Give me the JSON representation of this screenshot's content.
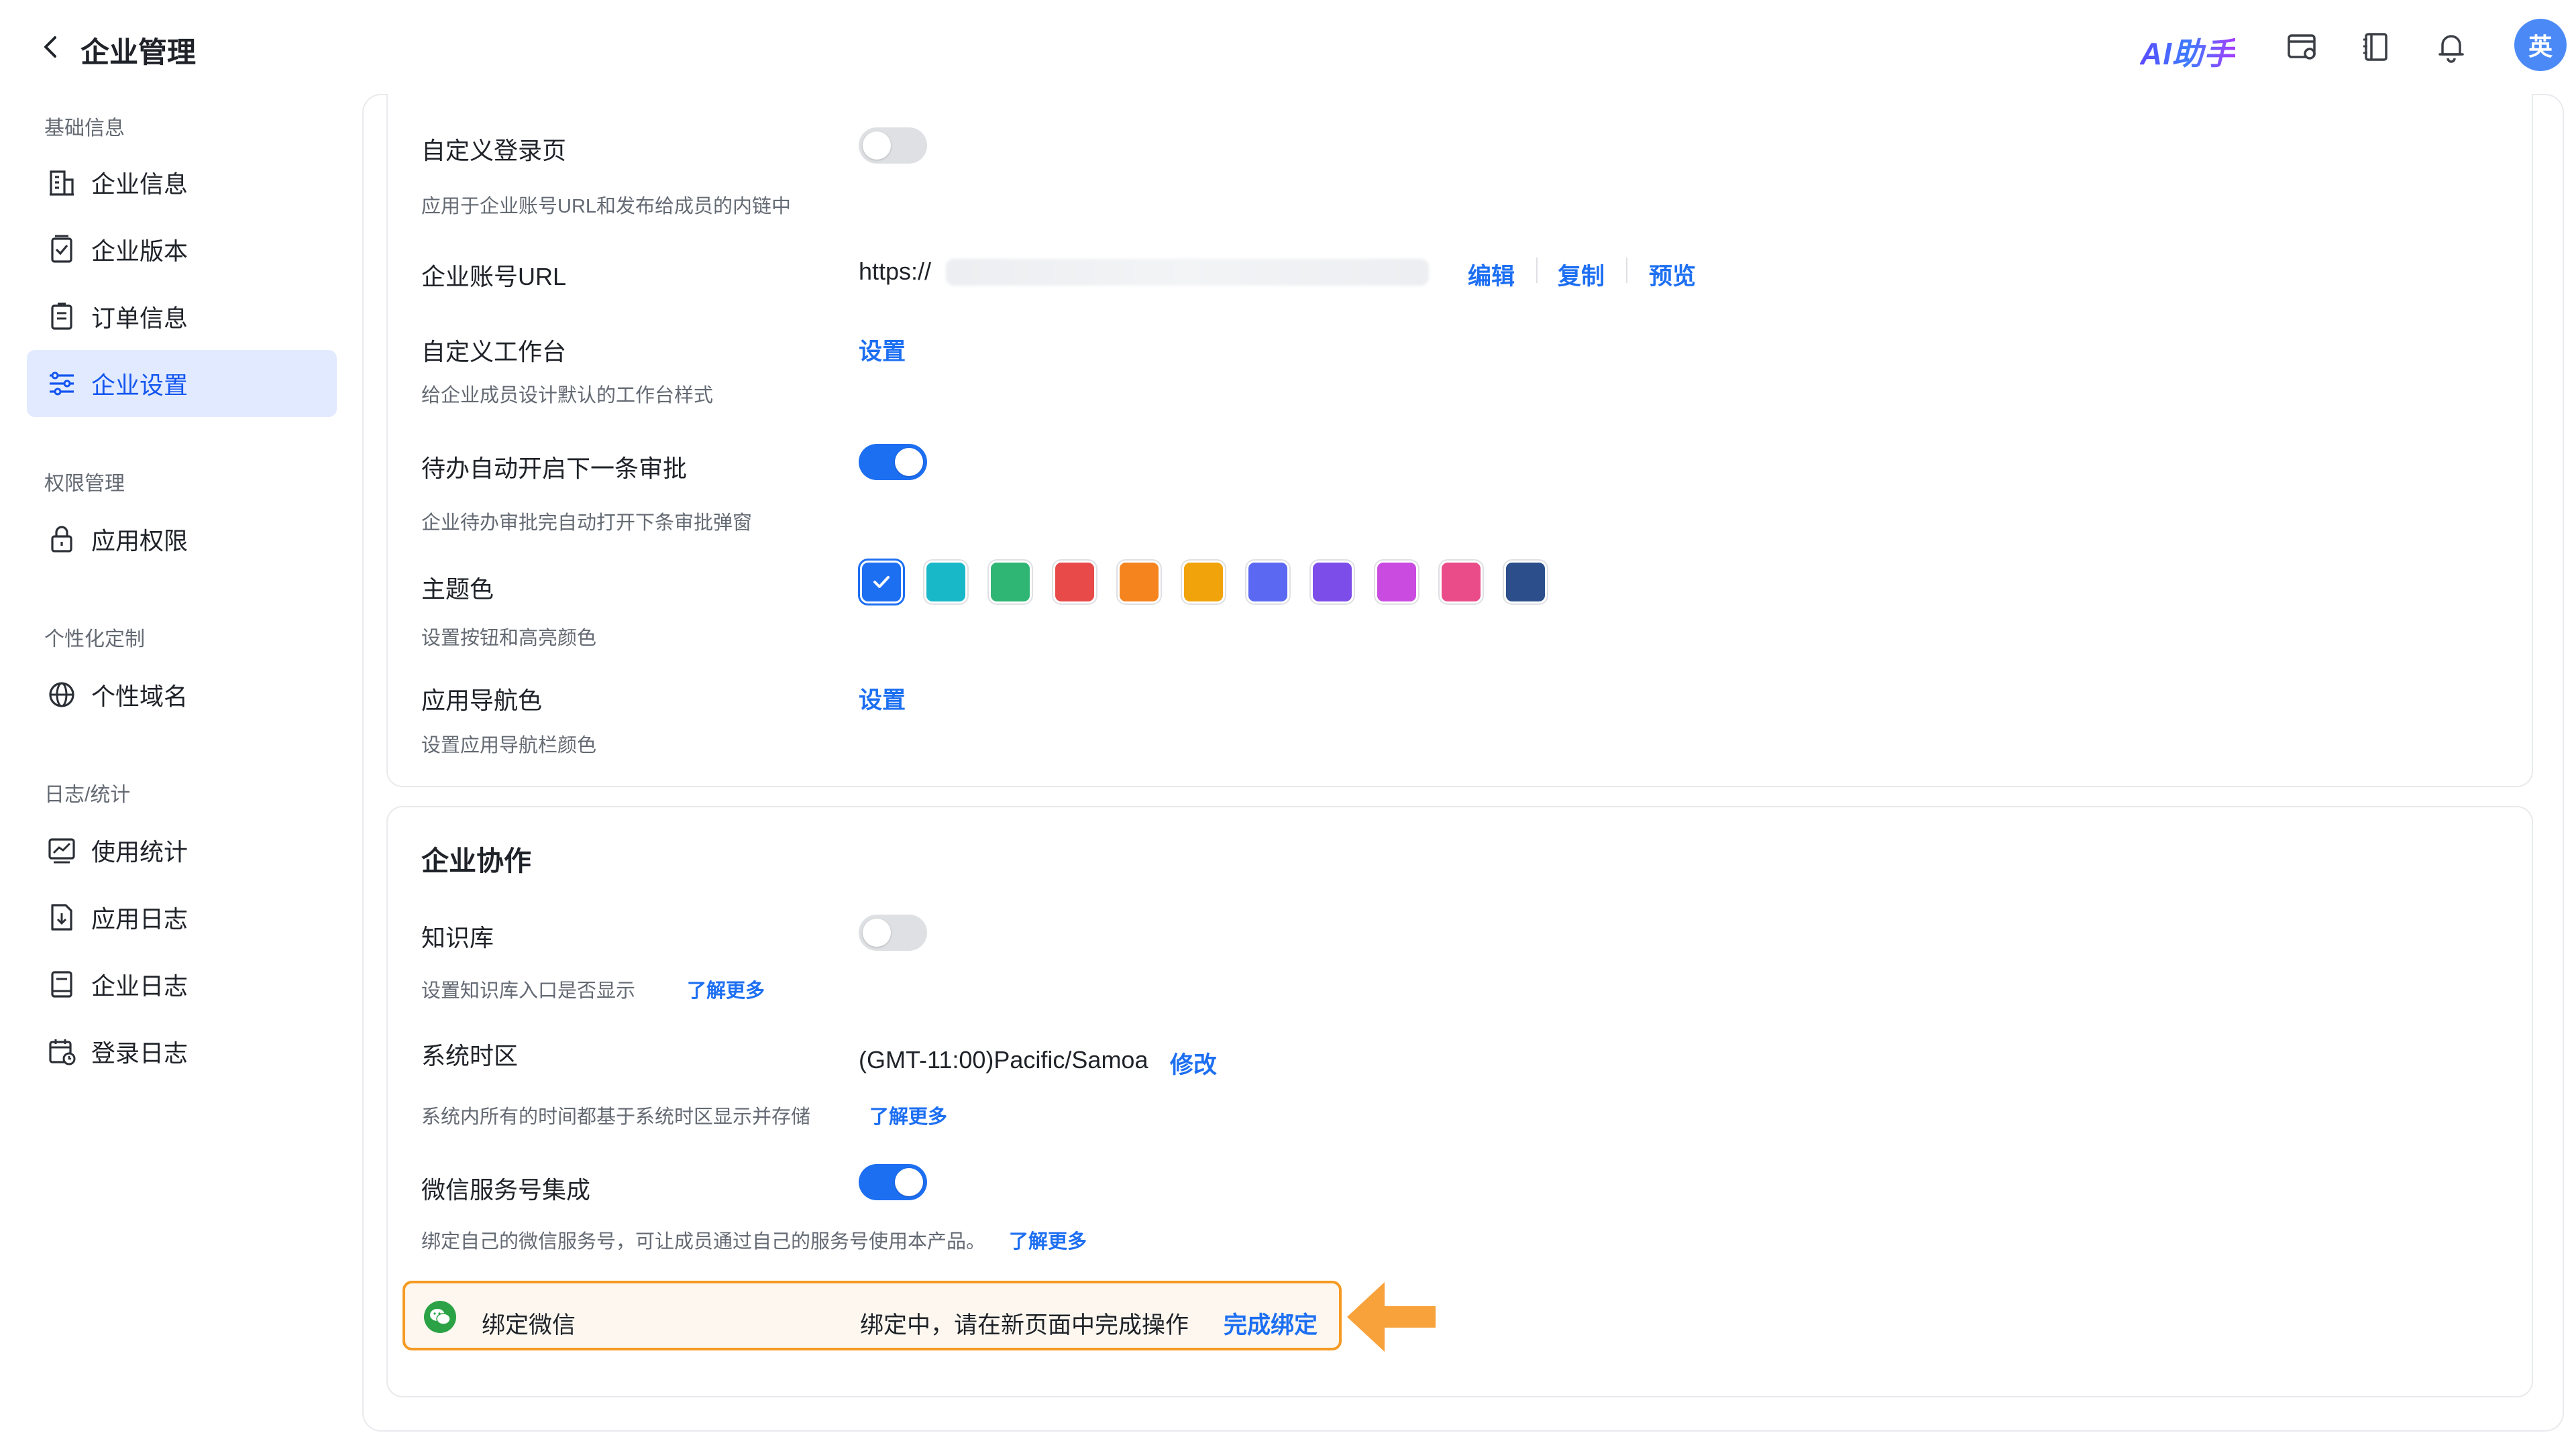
{
  "header": {
    "title": "企业管理",
    "ai_label": "AI助手",
    "avatar_text": "英"
  },
  "sidebar": {
    "groups": [
      {
        "title": "基础信息"
      },
      {
        "title": "权限管理"
      },
      {
        "title": "个性化定制"
      },
      {
        "title": "日志/统计"
      }
    ],
    "items": [
      {
        "label": "企业信息",
        "icon": "building-icon"
      },
      {
        "label": "企业版本",
        "icon": "version-icon"
      },
      {
        "label": "订单信息",
        "icon": "order-icon"
      },
      {
        "label": "企业设置",
        "icon": "settings-sliders-icon",
        "active": true
      },
      {
        "label": "应用权限",
        "icon": "lock-icon"
      },
      {
        "label": "个性域名",
        "icon": "globe-icon"
      },
      {
        "label": "使用统计",
        "icon": "chart-icon"
      },
      {
        "label": "应用日志",
        "icon": "download-doc-icon"
      },
      {
        "label": "企业日志",
        "icon": "book-icon"
      },
      {
        "label": "登录日志",
        "icon": "calendar-icon"
      }
    ]
  },
  "settings": {
    "custom_login": {
      "label": "自定义登录页",
      "desc": "应用于企业账号URL和发布给成员的内链中",
      "enabled": false
    },
    "account_url": {
      "label": "企业账号URL",
      "value_prefix": "https://",
      "edit": "编辑",
      "copy": "复制",
      "preview": "预览"
    },
    "custom_workbench": {
      "label": "自定义工作台",
      "desc": "给企业成员设计默认的工作台样式",
      "action": "设置"
    },
    "auto_next": {
      "label": "待办自动开启下一条审批",
      "desc": "企业待办审批完自动打开下条审批弹窗",
      "enabled": true
    },
    "theme": {
      "label": "主题色",
      "desc": "设置按钮和高亮颜色",
      "colors": [
        "#1d6ff2",
        "#19b8c9",
        "#2fb574",
        "#e84a4a",
        "#f5841f",
        "#f0a30a",
        "#5b68f2",
        "#7c4de8",
        "#c94be0",
        "#ea4c89",
        "#2c4f8c"
      ],
      "selected_index": 0
    },
    "nav_color": {
      "label": "应用导航色",
      "desc": "设置应用导航栏颜色",
      "action": "设置"
    }
  },
  "collab": {
    "title": "企业协作",
    "kb": {
      "label": "知识库",
      "desc": "设置知识库入口是否显示",
      "more": "了解更多",
      "enabled": false
    },
    "timezone": {
      "label": "系统时区",
      "value": "(GMT-11:00)Pacific/Samoa",
      "action": "修改",
      "desc": "系统内所有的时间都基于系统时区显示并存储",
      "more": "了解更多"
    },
    "wechat": {
      "label": "微信服务号集成",
      "desc": "绑定自己的微信服务号，可让成员通过自己的服务号使用本产品。",
      "more": "了解更多",
      "enabled": true
    },
    "bind": {
      "label": "绑定微信",
      "status": "绑定中，请在新页面中完成操作",
      "action": "完成绑定"
    }
  },
  "colors": {
    "accent": "#1d6ff2",
    "highlight_border": "#f59a23",
    "arrow": "#f7a23b"
  }
}
